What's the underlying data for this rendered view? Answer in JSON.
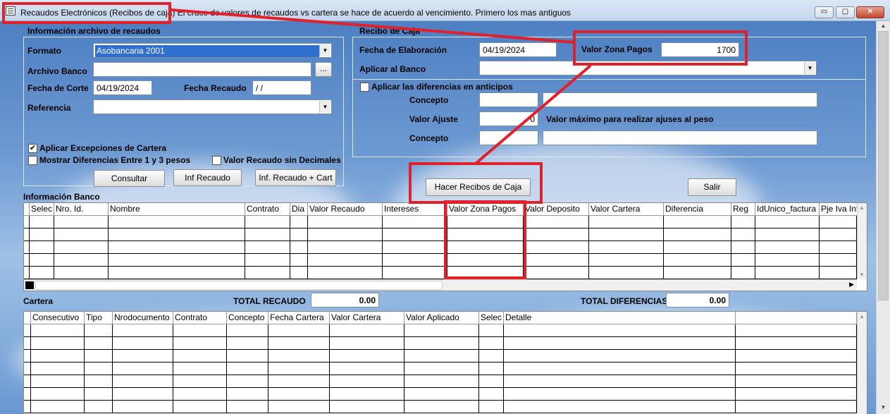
{
  "window": {
    "title": "Recaudos Electrónicos (Recibos de caja) El  cruce de valores de recaudos vs cartera se hace de acuerdo al vencimiento. Primero los mas antiguos",
    "minimize": "▭",
    "maximize": "▢",
    "close": "✕"
  },
  "archivo": {
    "group_label": "Información archivo de recaudos",
    "formato_label": "Formato",
    "formato_value": "Asobancaria 2001",
    "archivo_banco_label": "Archivo Banco",
    "archivo_banco_value": "",
    "browse_label": "...",
    "fecha_corte_label": "Fecha de Corte",
    "fecha_corte_value": "04/19/2024",
    "fecha_recaudo_label": "Fecha Recaudo",
    "fecha_recaudo_value": " / /",
    "referencia_label": "Referencia",
    "referencia_value": "",
    "aplicar_excepciones_label": "Aplicar Excepciones de Cartera",
    "aplicar_excepciones_checked": true,
    "mostrar_diferencias_label": "Mostrar Diferencias Entre 1 y 3 pesos",
    "mostrar_diferencias_checked": false,
    "valor_sin_decimales_label": "Valor Recaudo sin Decimales",
    "valor_sin_decimales_checked": false,
    "consultar_label": "Consultar",
    "inf_recaudo_label": "Inf Recaudo",
    "inf_recaudo_cart_label": "Inf. Recaudo + Cart"
  },
  "recibo": {
    "group_label": "Recibo de Caja",
    "fecha_elaboracion_label": "Fecha de Elaboración",
    "fecha_elaboracion_value": "04/19/2024",
    "valor_zona_label": "Valor Zona Pagos",
    "valor_zona_value": "1700",
    "aplicar_banco_label": "Aplicar al Banco",
    "aplicar_banco_value": "",
    "aplicar_diferencias_label": "Aplicar las diferencias en anticipos",
    "aplicar_diferencias_checked": false,
    "concepto1_label": "Concepto",
    "valor_ajuste_label": "Valor Ajuste",
    "valor_ajuste_value": "0",
    "valor_maximo_label": "Valor máximo para realizar ajuses al peso",
    "concepto2_label": "Concepto",
    "hacer_recibos_label": "Hacer Recibos de Caja",
    "salir_label": "Salir"
  },
  "banco": {
    "label": "Información Banco",
    "columns": [
      "Selec",
      "Nro. Id.",
      "Nombre",
      "Contrato",
      "Dia",
      "Valor Recaudo",
      "Intereses",
      "Valor Zona Pagos",
      "Valor Deposito",
      "Valor Cartera",
      "Diferencia",
      "Reg",
      "IdUnico_factura",
      "Pje Iva Int"
    ]
  },
  "cartera": {
    "label": "Cartera",
    "total_recaudo_label": "TOTAL RECAUDO",
    "total_recaudo_value": "0.00",
    "total_diferencias_label": "TOTAL DIFERENCIAS",
    "total_diferencias_value": "0.00",
    "columns": [
      "Consecutivo",
      "Tipo",
      "Nrodocumento",
      "Contrato",
      "Concepto",
      "Fecha Cartera",
      "Valor Cartera",
      "Valor Aplicado",
      "Selec",
      "Detalle"
    ]
  },
  "colors": {
    "annotation_red": "#e0202a",
    "selection_blue": "#2f6fd0",
    "background_sky": "#6f9bd3"
  },
  "icons": {
    "window_icon": "table-icon",
    "dropdown": "chevron-down-icon",
    "checkmark": "✔"
  }
}
